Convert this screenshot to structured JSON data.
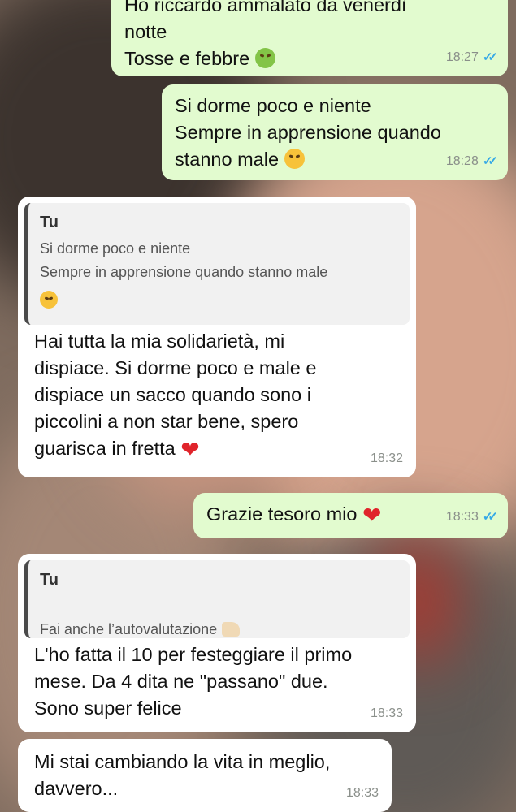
{
  "messages": [
    {
      "id": "m1",
      "dir": "out",
      "partial_top": "Ho riccardo ammalato da venerdì",
      "lines": "notte\nTosse e febbre",
      "emoji": "nauseated-face-icon",
      "time": "18:27",
      "status": "read"
    },
    {
      "id": "m2",
      "dir": "out",
      "lines": "Si dorme poco e niente\nSempre in apprensione quando\nstanno male",
      "emoji": "persevering-face-icon",
      "time": "18:28",
      "status": "read"
    },
    {
      "id": "m3",
      "dir": "in",
      "quote": {
        "author": "Tu",
        "text": "Si dorme poco e niente\nSempre in apprensione quando stanno male"
      },
      "lines": "Hai tutta la mia solidarietà, mi\ndispiace. Si dorme poco e male e\ndispiace un sacco quando sono i\npiccolini a non star bene, spero\nguarisca in fretta",
      "emoji": "red-heart-icon",
      "time": "18:32"
    },
    {
      "id": "m4",
      "dir": "out",
      "lines": "Grazie tesoro mio",
      "emoji": "red-heart-icon",
      "time": "18:33",
      "status": "read"
    },
    {
      "id": "m5",
      "dir": "in",
      "quote": {
        "author": "Tu",
        "text": "Fai anche l’autovalutazione"
      },
      "lines": "L'ho fatta il 10 per festeggiare il primo\nmese. Da 4 dita ne \"passano\" due.\nSono super felice",
      "time": "18:33"
    },
    {
      "id": "m6",
      "dir": "in",
      "lines": "Mi stai cambiando la vita in meglio,\ndavvero...",
      "time": "18:33"
    }
  ],
  "colors": {
    "outgoing": "#e2fbcf",
    "incoming": "#ffffff",
    "read_ticks": "#34a8e6",
    "heart": "#e0242b"
  }
}
